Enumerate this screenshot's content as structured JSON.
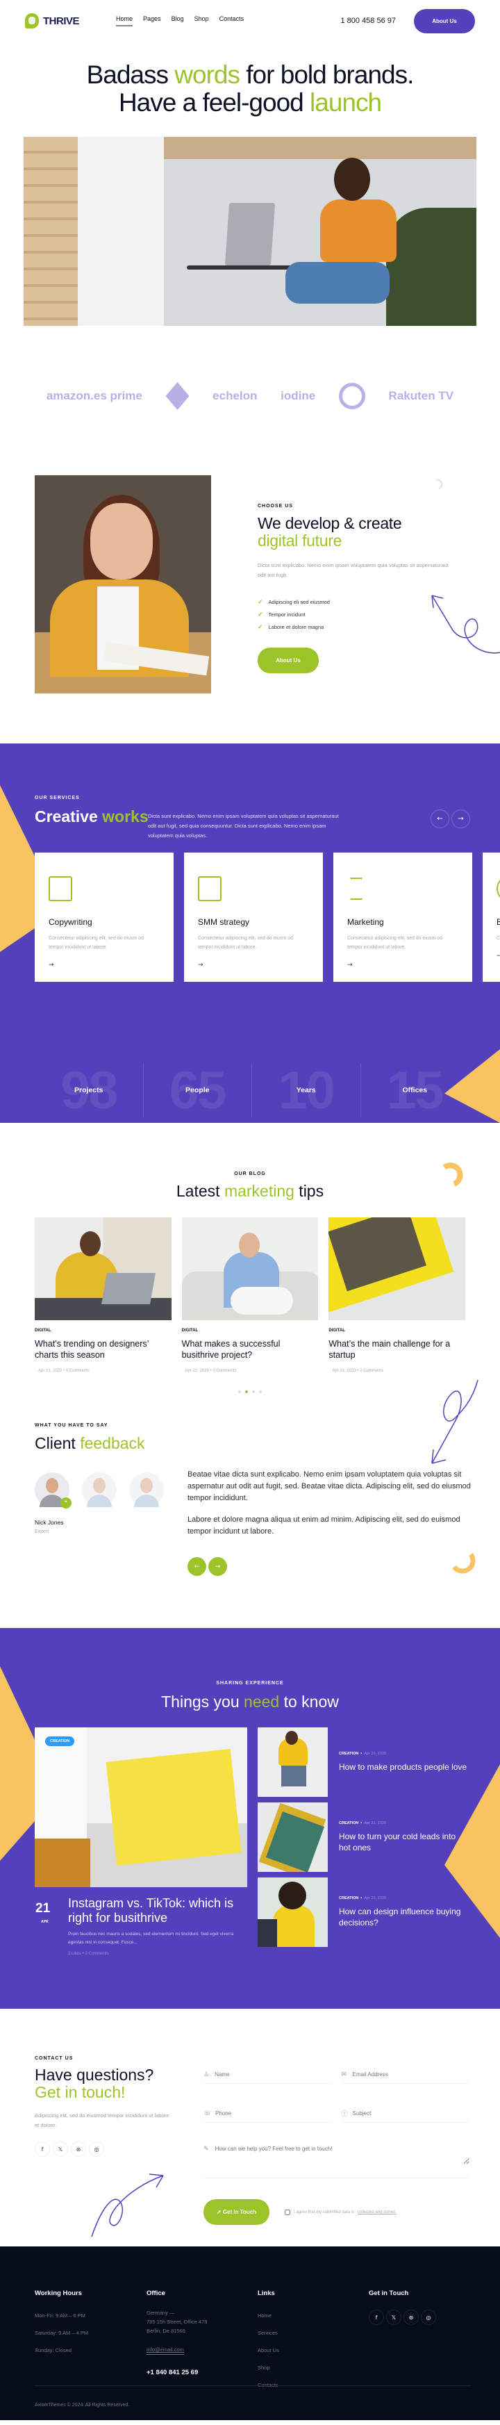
{
  "header": {
    "logo_text": "THRIVE",
    "nav": [
      {
        "label": "Home",
        "active": true
      },
      {
        "label": "Pages"
      },
      {
        "label": "Blog"
      },
      {
        "label": "Shop"
      },
      {
        "label": "Contacts"
      }
    ],
    "phone": "1 800 458 56 97",
    "cta_label": "About Us"
  },
  "hero": {
    "line1_a": "Badass ",
    "line1_accent": "words",
    "line1_b": " for bold brands.",
    "line2_a": "Have a feel-good ",
    "line2_accent": "launch"
  },
  "logos": [
    "amazon.es prime",
    "diamond-logo",
    "echelon",
    "iodine",
    "chart-logo",
    "Rakuten TV"
  ],
  "choose": {
    "eyebrow": "CHOOSE US",
    "title_a": "We develop & create",
    "title_accent": "digital future",
    "desc": "Dicta sunt explicabo. Nemo enim ipsam voluptatem quia voluptas sit aspernaturaut odit aut fugit.",
    "checks": [
      "Adipiscing eli sed eiusmod",
      "Tempor incidunt",
      "Labore et dolore magna"
    ],
    "button": "About Us"
  },
  "services": {
    "eyebrow": "OUR SERVICES",
    "title_a": "Creative ",
    "title_accent": "works",
    "desc": "Dicta sunt explicabo. Nemo enim ipsam voluptatem quia voluptas sit aspernaturaut odit aut fugit, sed quia consequuntur. Dicta sunt explicabo. Nemo enim ipsam voluptatem quia voluptas.",
    "prev_icon": "←",
    "next_icon": "→",
    "cards": [
      {
        "title": "Copywriting",
        "text": "Consectetur adipiscing elit, sed do eiusm od tempor incididunt ut labore.",
        "icon": "analytics-icon"
      },
      {
        "title": "SMM strategy",
        "text": "Consectetur adipiscing elit, sed do eiusm od tempor incididunt ut labore.",
        "icon": "monitor-chart-icon"
      },
      {
        "title": "Marketing",
        "text": "Consectetur adipiscing elit, sed do eiusm od tempor incididunt ut labore.",
        "icon": "hourglass-icon"
      },
      {
        "title": "B",
        "text": "Co te",
        "icon": "gear-icon"
      }
    ],
    "more_icon": "→",
    "stats": [
      {
        "number": "98",
        "label": "Projects"
      },
      {
        "number": "65",
        "label": "People"
      },
      {
        "number": "10",
        "label": "Years"
      },
      {
        "number": "15",
        "label": "Offices"
      }
    ]
  },
  "blog": {
    "eyebrow": "OUR BLOG",
    "title_a": "Latest ",
    "title_accent": "marketing",
    "title_b": " tips",
    "posts": [
      {
        "category": "DIGITAL",
        "title": "What’s trending on designers’ charts this season",
        "meta": "Apr 21, 2020  •  0 Comments"
      },
      {
        "category": "DIGITAL",
        "title": "What makes a successful busithrive project?",
        "meta": "Apr 21, 2020  •  0 Comments"
      },
      {
        "category": "DIGITAL",
        "title": "What’s the main challenge for a startup",
        "meta": "Apr 21, 2020  •  0 Comments"
      }
    ],
    "dots": 4,
    "active_dot": 1
  },
  "feedback": {
    "eyebrow": "WHAT YOU HAVE TO SAY",
    "title_a": "Client ",
    "title_accent": "feedback",
    "name": "Nick Jones",
    "role": "Expert",
    "quote_icon": "❞",
    "p1": "Beatae vitae dicta sunt explicabo. Nemo enim ipsam voluptatem quia voluptas sit aspernatur aut odit aut fugit, sed. Beatae vitae dicta. Adipiscing elit, sed do eiusmod tempor incididunt.",
    "p2": "Labore et dolore magna aliqua ut enim ad minim. Adipiscing elit, sed do euismod tempor incidunt ut labore.",
    "prev_icon": "←",
    "next_icon": "→"
  },
  "things": {
    "eyebrow": "SHARING EXPERIENCE",
    "title_a": "Things you ",
    "title_accent": "need",
    "title_b": " to know",
    "featured": {
      "badge": "CREATION",
      "day": "21",
      "month": "APR",
      "title": "Instagram vs. TikTok: which is right for busithrive",
      "desc": "Proin faucibus nec mauris a sodales, sed elementum mi tincidunt. Sed eget viverra egestas nisi in consequat. Fusce...",
      "meta": "2 Likes  •  0 Comments"
    },
    "side": [
      {
        "category": "CREATION",
        "date": "Apr 21, 2020",
        "title": "How to make products people love"
      },
      {
        "category": "CREATION",
        "date": "Apr 21, 2020",
        "title": "How to turn your cold leads into hot ones"
      },
      {
        "category": "CREATION",
        "date": "Apr 21, 2020",
        "title": "How can design influence buying decisions?"
      }
    ]
  },
  "contact": {
    "eyebrow": "CONTACT US",
    "title_a": "Have questions?",
    "title_accent": "Get in touch!",
    "desc": "Adipiscing elit, sed do eiusmod tempor incididunt ut labore et dolore.",
    "socials": [
      {
        "name": "facebook-icon",
        "glyph": "f"
      },
      {
        "name": "x-icon",
        "glyph": "𝕏"
      },
      {
        "name": "dribbble-icon",
        "glyph": "⊛"
      },
      {
        "name": "instagram-icon",
        "glyph": "◎"
      }
    ],
    "fields": {
      "name": "Name",
      "email": "Email Address",
      "phone": "Phone",
      "subject": "Subject",
      "message": "How can we help you? Feel free to get in touch!"
    },
    "submit": "Get In Touch",
    "agree_text": "I agree that my submitted data is ",
    "agree_link": "collected and stored."
  },
  "footer": {
    "hours_title": "Working Hours",
    "hours": [
      "Mon-Fri: 9 AM – 6 PM",
      "Saturday: 9 AM – 4 PM",
      "Sunday: Closed"
    ],
    "office_title": "Office",
    "address": [
      "Germany —",
      "785 15h Street, Office 478",
      "Berlin, De 81566"
    ],
    "email": "info@email.com",
    "phone": "+1 840 841 25 69",
    "links_title": "Links",
    "links": [
      "Home",
      "Services",
      "About Us",
      "Shop",
      "Contacts"
    ],
    "touch_title": "Get in Touch",
    "copyright": "AxiomThemes © 2024. All Rights Reserved."
  },
  "colors": {
    "accent_green": "#9cc329",
    "brand_purple": "#5540bb",
    "accent_yellow": "#f8c462",
    "footer_bg": "#050d1b",
    "dark_text": "#0d1126"
  }
}
